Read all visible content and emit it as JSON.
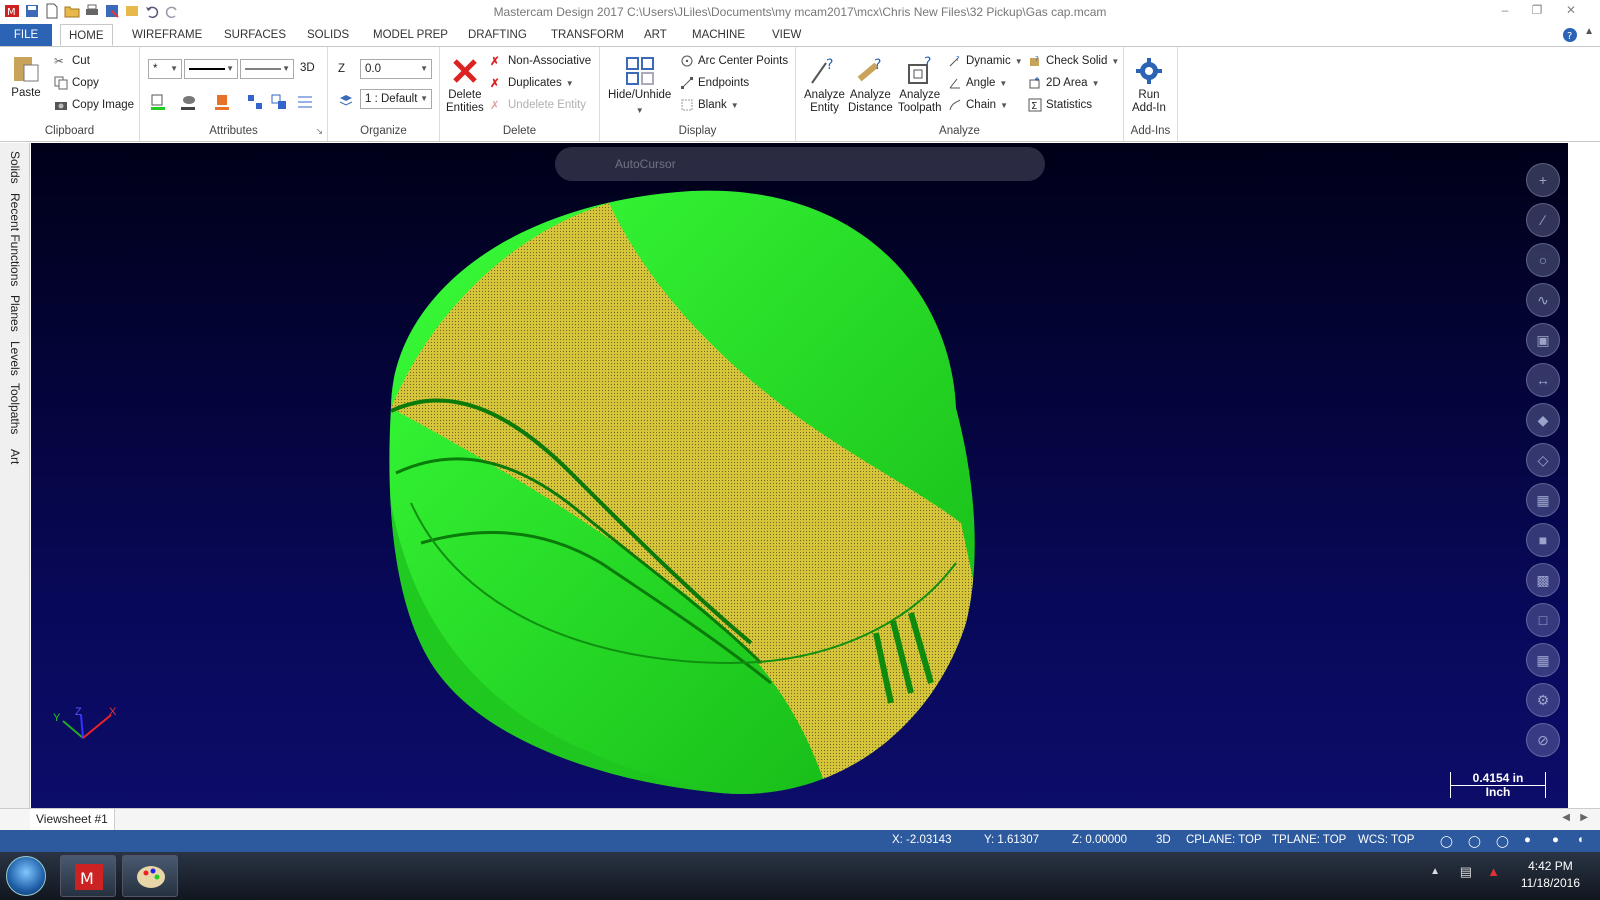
{
  "title": "Mastercam Design 2017  C:\\Users\\JLiles\\Documents\\my mcam2017\\mcx\\Chris New Files\\32 Pickup\\Gas cap.mcam",
  "tabs": [
    "FILE",
    "HOME",
    "WIREFRAME",
    "SURFACES",
    "SOLIDS",
    "MODEL PREP",
    "DRAFTING",
    "TRANSFORM",
    "ART",
    "MACHINE",
    "VIEW"
  ],
  "active_tab": "HOME",
  "ribbon": {
    "clipboard": {
      "label": "Clipboard",
      "paste": "Paste",
      "cut": "Cut",
      "copy": "Copy",
      "copy_image": "Copy Image"
    },
    "attributes": {
      "label": "Attributes",
      "point_style": "*",
      "mode_3d": "3D"
    },
    "organize": {
      "label": "Organize",
      "z_label": "Z",
      "z_value": "0.0",
      "level": "1 : Default"
    },
    "delete": {
      "label": "Delete",
      "delete_entities": "Delete\nEntities",
      "non_associative": "Non-Associative",
      "duplicates": "Duplicates",
      "undelete_entity": "Undelete Entity"
    },
    "display": {
      "label": "Display",
      "hide_unhide": "Hide/Unhide",
      "arc_center_points": "Arc Center Points",
      "endpoints": "Endpoints",
      "blank": "Blank"
    },
    "analyze": {
      "label": "Analyze",
      "analyze_entity": "Analyze\nEntity",
      "analyze_distance": "Analyze\nDistance",
      "analyze_toolpath": "Analyze\nToolpath",
      "dynamic": "Dynamic",
      "angle": "Angle",
      "chain": "Chain",
      "check_solid": "Check Solid",
      "area_2d": "2D Area",
      "statistics": "Statistics"
    },
    "addins": {
      "label": "Add-Ins",
      "run_addin": "Run\nAdd-In"
    }
  },
  "left_tabs": [
    "Solids",
    "Recent Functions",
    "Planes",
    "Levels",
    "Toolpaths",
    "Art"
  ],
  "viewport": {
    "autocursor": "AutoCursor",
    "scale_value": "0.4154 in",
    "scale_unit": "Inch",
    "axis_labels": {
      "x": "X",
      "y": "Y",
      "z": "Z"
    },
    "colors": {
      "green": "#22dd22",
      "yellow": "#d8c63a",
      "background": "#08085a"
    }
  },
  "sheet_tab": "Viewsheet #1",
  "status": {
    "x": "X:  -2.03143",
    "y": "Y:  1.61307",
    "z": "Z:  0.00000",
    "mode": "3D",
    "cplane": "CPLANE: TOP",
    "tplane": "TPLANE: TOP",
    "wcs": "WCS: TOP"
  },
  "taskbar": {
    "time": "4:42 PM",
    "date": "11/18/2016"
  }
}
